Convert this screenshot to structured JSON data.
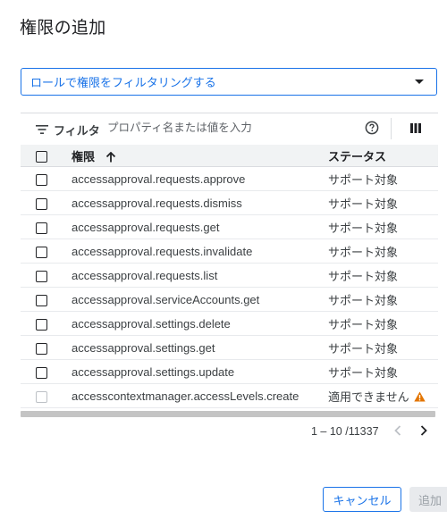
{
  "dialog": {
    "title": "権限の追加"
  },
  "role_filter": {
    "label": "ロールで権限をフィルタリングする"
  },
  "filter_bar": {
    "label": "フィルタ",
    "placeholder": "プロパティ名または値を入力",
    "icons": {
      "filter": "filter-lines-icon",
      "help": "help-circle-icon",
      "columns": "column-display-icon"
    }
  },
  "table": {
    "columns": {
      "permission": "権限",
      "status": "ステータス"
    },
    "rows": [
      {
        "permission": "accessapproval.requests.approve",
        "status": "サポート対象"
      },
      {
        "permission": "accessapproval.requests.dismiss",
        "status": "サポート対象"
      },
      {
        "permission": "accessapproval.requests.get",
        "status": "サポート対象"
      },
      {
        "permission": "accessapproval.requests.invalidate",
        "status": "サポート対象"
      },
      {
        "permission": "accessapproval.requests.list",
        "status": "サポート対象"
      },
      {
        "permission": "accessapproval.serviceAccounts.get",
        "status": "サポート対象"
      },
      {
        "permission": "accessapproval.settings.delete",
        "status": "サポート対象"
      },
      {
        "permission": "accessapproval.settings.get",
        "status": "サポート対象"
      },
      {
        "permission": "accessapproval.settings.update",
        "status": "サポート対象"
      },
      {
        "permission": "accesscontextmanager.accessLevels.create",
        "status": "適用できません",
        "warning": true
      }
    ]
  },
  "pagination": {
    "range": "1 – 10 /11337"
  },
  "actions": {
    "cancel": "キャンセル",
    "add": "追加"
  },
  "colors": {
    "accent": "#1a73e8",
    "warning": "#e37400"
  }
}
